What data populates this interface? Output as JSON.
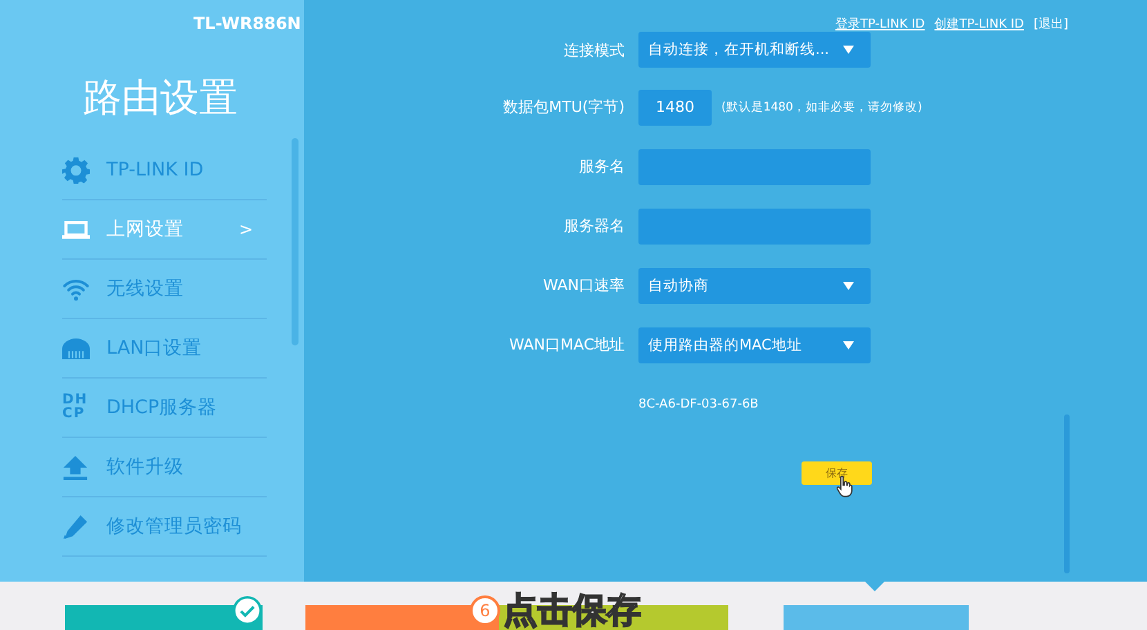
{
  "header": {
    "model": "TL-WR886N",
    "links": [
      "登录TP-LINK ID",
      "创建TP-LINK ID",
      "[退出]"
    ]
  },
  "sidebar": {
    "title": "路由设置",
    "items": [
      {
        "label": "TP-LINK ID",
        "selected": false
      },
      {
        "label": "上网设置",
        "selected": true,
        "arrow": ">"
      },
      {
        "label": "无线设置",
        "selected": false
      },
      {
        "label": "LAN口设置",
        "selected": false
      },
      {
        "label": "DHCP服务器",
        "icon_text": [
          "DH",
          "CP"
        ],
        "selected": false
      },
      {
        "label": "软件升级",
        "selected": false
      },
      {
        "label": "修改管理员密码",
        "selected": false
      }
    ]
  },
  "form": {
    "rows": [
      {
        "kind": "select",
        "label": "连接模式",
        "value": "自动连接，在开机和断线..."
      },
      {
        "kind": "input",
        "label": "数据包MTU(字节)",
        "value": "1480",
        "hint": "(默认是1480，如非必要，请勿修改)"
      },
      {
        "kind": "input",
        "label": "服务名"
      },
      {
        "kind": "input",
        "label": "服务器名"
      },
      {
        "kind": "select",
        "label": "WAN口速率",
        "value": "自动协商"
      },
      {
        "kind": "select",
        "label": "WAN口MAC地址",
        "value": "使用路由器的MAC地址"
      }
    ],
    "mac": "8C-A6-DF-03-67-6B",
    "save_button": "保存"
  },
  "bottom_cards": [
    {
      "color": "#12b7b3",
      "checked": true
    },
    {
      "color": "#ff7e3f",
      "checked": false
    },
    {
      "color": "#b5c92e",
      "checked": false
    },
    {
      "color": "#5bbbe9",
      "checked": false
    }
  ],
  "caption": {
    "step": "6",
    "text": "点击保存"
  }
}
